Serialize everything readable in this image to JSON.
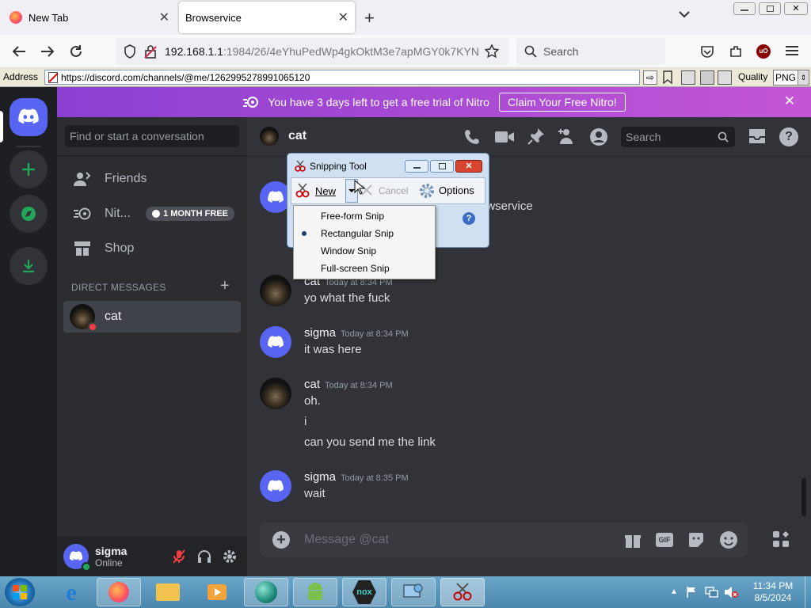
{
  "browser": {
    "tabs": [
      {
        "label": "New Tab"
      },
      {
        "label": "Browservice"
      }
    ],
    "url": {
      "host": "192.168.1.1",
      "rest": ":1984/26/4eYhuPedWp4gkOktM3e7apMGY0k7KYN"
    },
    "search_placeholder": "Search"
  },
  "addressbar": {
    "label": "Address",
    "url": "https://discord.com/channels/@me/1262995278991065120",
    "quality_label": "Quality",
    "format": "PNG"
  },
  "nitro_banner": {
    "text": "You have 3 days left to get a free trial of Nitro",
    "cta": "Claim Your Free Nitro!"
  },
  "sidebar": {
    "search_placeholder": "Find or start a conversation",
    "items": [
      {
        "label": "Friends"
      },
      {
        "label": "Nit...",
        "badge": "1 MONTH FREE"
      },
      {
        "label": "Shop"
      }
    ],
    "dm_header": "DIRECT MESSAGES",
    "dms": [
      {
        "name": "cat"
      }
    ]
  },
  "user": {
    "name": "sigma",
    "status": "Online"
  },
  "chat": {
    "title": "cat",
    "search_placeholder": "Search",
    "partial_text": "owservice",
    "composer_placeholder": "Message @cat",
    "messages": [
      {
        "author": "cat",
        "time": "Today at 8:34 PM",
        "lines": [
          "yo what the fuck"
        ]
      },
      {
        "author": "sigma",
        "time": "Today at 8:34 PM",
        "lines": [
          "it was here"
        ]
      },
      {
        "author": "cat",
        "time": "Today at 8:34 PM",
        "lines": [
          "oh.",
          "i",
          "can you send me the link"
        ]
      },
      {
        "author": "sigma",
        "time": "Today at 8:35 PM",
        "lines": [
          "wait"
        ]
      }
    ]
  },
  "snipping_tool": {
    "title": "Snipping Tool",
    "new_label": "New",
    "cancel_label": "Cancel",
    "options_label": "Options",
    "menu": [
      "Free-form Snip",
      "Rectangular Snip",
      "Window Snip",
      "Full-screen Snip"
    ],
    "selected": "Rectangular Snip"
  },
  "taskbar": {
    "time": "11:34 PM",
    "date": "8/5/2024"
  },
  "colors": {
    "blurple": "#5865f2",
    "nitro": "#b845d4",
    "discord_bg": "#313338",
    "green": "#23a55a"
  }
}
